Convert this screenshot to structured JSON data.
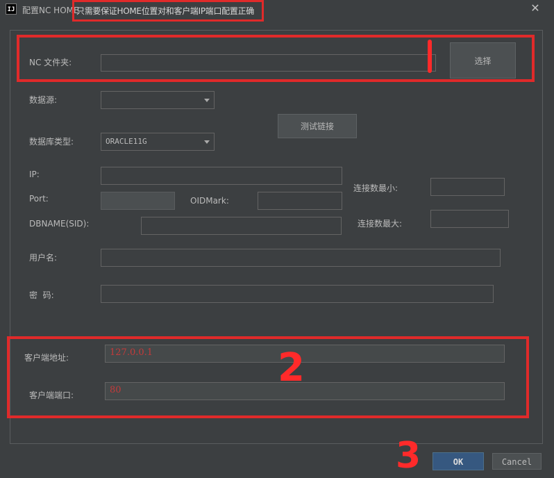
{
  "window": {
    "title": "配置NC HOME",
    "app_icon": "IJ",
    "annotation_note": "只需要保证HOME位置对和客户端IP端口配置正确",
    "close_icon": "close-icon"
  },
  "form": {
    "nc_folder_label": "NC 文件夹:",
    "nc_folder_value": "",
    "choose_button": "选择",
    "datasource_label": "数据源:",
    "datasource_value": "",
    "test_link_button": "测试链接",
    "db_type_label": "数据库类型:",
    "db_type_value": "ORACLE11G",
    "ip_label": "IP:",
    "ip_value": "",
    "port_label": "Port:",
    "port_value": "",
    "oidmark_label": "OIDMark:",
    "oidmark_value": "",
    "dbname_label": "DBNAME(SID):",
    "dbname_value": "",
    "min_conn_label": "连接数最小:",
    "min_conn_value": "",
    "max_conn_label": "连接数最大:",
    "max_conn_value": "",
    "username_label": "用户名:",
    "username_value": "",
    "password_label": "密  码:",
    "password_value": "",
    "client_address_label": "客户端地址:",
    "client_address_value": "127.0.0.1",
    "client_port_label": "客户端端口:",
    "client_port_value": "80"
  },
  "footer": {
    "ok_button": "OK",
    "cancel_button": "Cancel"
  },
  "annotations": {
    "mark_1": "1",
    "mark_2": "2",
    "mark_3": "3"
  },
  "colors": {
    "background": "#3c3f41",
    "field": "#45494a",
    "primary_button": "#365880",
    "annotation_red": "#e02a2a"
  }
}
